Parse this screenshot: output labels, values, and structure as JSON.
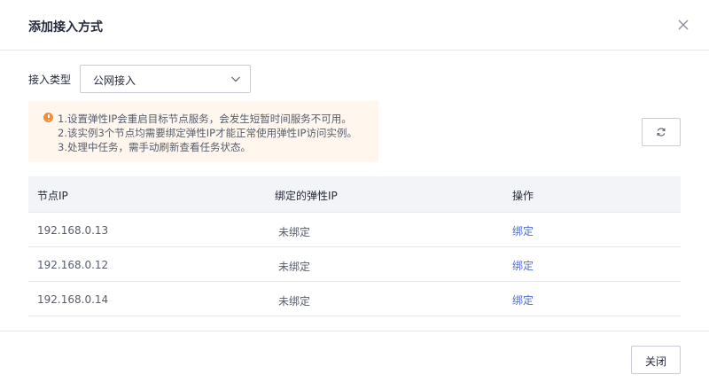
{
  "dialog": {
    "title": "添加接入方式",
    "close_icon": "close-icon"
  },
  "access_type": {
    "label": "接入类型",
    "selected": "公网接入",
    "dropdown_icon": "chevron-down-icon"
  },
  "notice": {
    "icon": "warning-circle-icon",
    "color": "#f0903f",
    "lines": [
      "1.设置弹性IP会重启目标节点服务，会发生短暂时间服务不可用。",
      "2.该实例3个节点均需要绑定弹性IP才能正常使用弹性IP访问实例。",
      "3.处理中任务，需手动刷新查看任务状态。"
    ]
  },
  "refresh": {
    "icon": "refresh-icon"
  },
  "table": {
    "headers": [
      "节点IP",
      "绑定的弹性IP",
      "操作"
    ],
    "rows": [
      {
        "ip": "192.168.0.13",
        "eip": "未绑定",
        "action": "绑定"
      },
      {
        "ip": "192.168.0.12",
        "eip": "未绑定",
        "action": "绑定"
      },
      {
        "ip": "192.168.0.14",
        "eip": "未绑定",
        "action": "绑定"
      }
    ]
  },
  "footer": {
    "close_label": "关闭"
  },
  "colors": {
    "link": "#526ecc",
    "warning": "#f0903f",
    "notice_bg": "#fff7ee"
  }
}
